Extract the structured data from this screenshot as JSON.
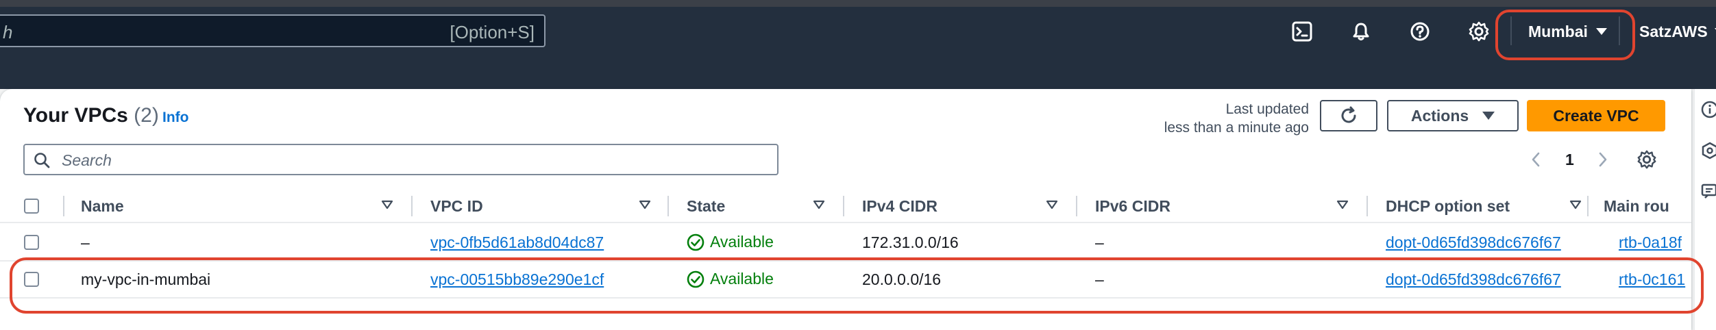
{
  "nav": {
    "search_placeholder": "h",
    "search_shortcut": "[Option+S]",
    "region": "Mumbai",
    "account": "SatzAWS",
    "icons": [
      "cloudshell-icon",
      "bell-icon",
      "help-icon",
      "settings-icon"
    ]
  },
  "header": {
    "title": "Your VPCs",
    "count": "(2)",
    "info": "Info",
    "last_updated_label": "Last updated",
    "last_updated_value": "less than a minute ago",
    "actions_label": "Actions",
    "create_label": "Create VPC"
  },
  "filter": {
    "placeholder": "Search"
  },
  "pagination": {
    "current_page": "1"
  },
  "table": {
    "columns": [
      "Name",
      "VPC ID",
      "State",
      "IPv4 CIDR",
      "IPv6 CIDR",
      "DHCP option set",
      "Main rou"
    ],
    "rows": [
      {
        "name": "–",
        "vpc_id": "vpc-0fb5d61ab8d04dc87",
        "state": "Available",
        "ipv4": "172.31.0.0/16",
        "ipv6": "–",
        "dhcp": "dopt-0d65fd398dc676f67",
        "main_route": "rtb-0a18f"
      },
      {
        "name": "my-vpc-in-mumbai",
        "vpc_id": "vpc-00515bb89e290e1cf",
        "state": "Available",
        "ipv4": "20.0.0.0/16",
        "ipv6": "–",
        "dhcp": "dopt-0d65fd398dc676f67",
        "main_route": "rtb-0c161"
      }
    ]
  },
  "colors": {
    "nav_bg": "#232f3e",
    "primary_button": "#ff9900",
    "link": "#0972d3",
    "available": "#037f0c",
    "highlight": "#e0442f"
  }
}
